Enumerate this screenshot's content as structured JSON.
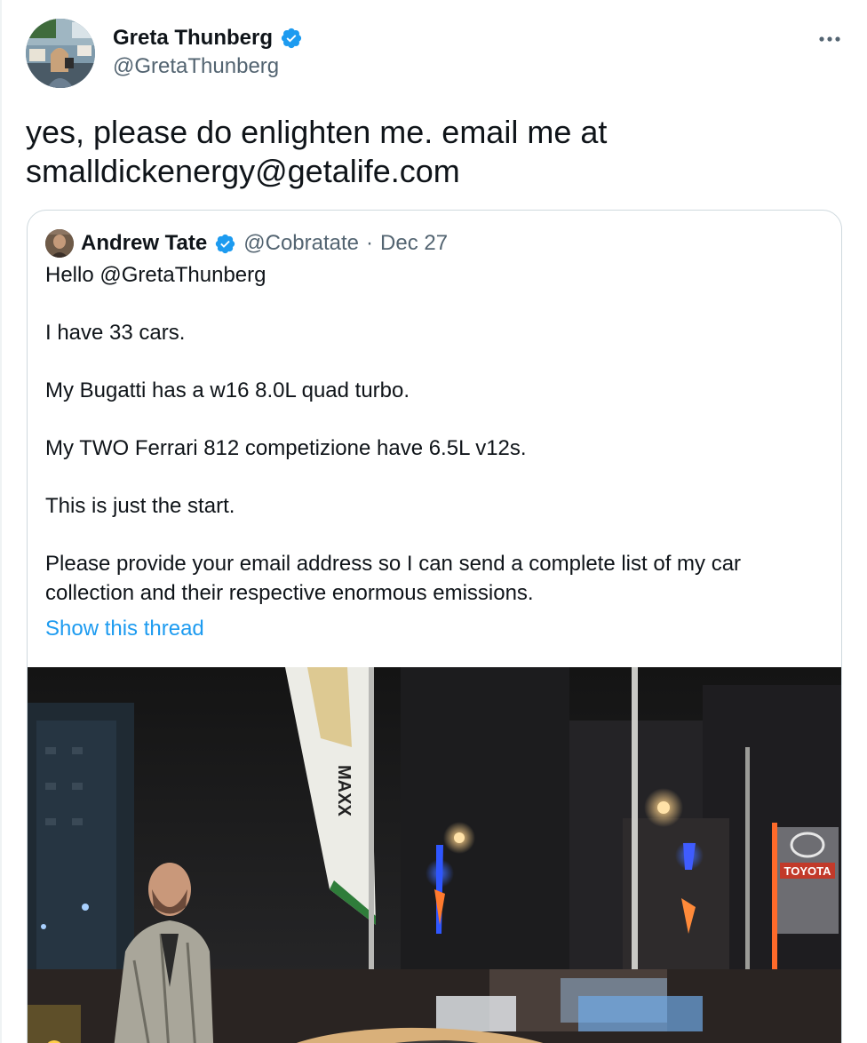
{
  "tweet": {
    "author": {
      "name": "Greta Thunberg",
      "handle": "@GretaThunberg",
      "verified": true
    },
    "text_lines": [
      "yes, please do enlighten me. email me at",
      "smalldickenergy@getalife.com"
    ],
    "more_icon": "more-horizontal-icon"
  },
  "quoted_tweet": {
    "author": {
      "name": "Andrew Tate",
      "handle": "@Cobratate",
      "verified": true
    },
    "separator": "·",
    "date": "Dec 27",
    "paragraphs": [
      "Hello @GretaThunberg",
      "I have 33 cars.",
      "My Bugatti has a w16 8.0L quad turbo.",
      "My TWO Ferrari 812 competizione have 6.5L v12s.",
      "This is just the start.",
      "Please provide your email address so I can send a complete list of my car collection and their respective enormous emissions."
    ],
    "show_thread": "Show this thread",
    "image": {
      "banner_text": "MAXX",
      "sign_text": "TOYOTA"
    }
  },
  "colors": {
    "link": "#1d9bf0",
    "verified": "#1d9bf0",
    "secondary_text": "#536471",
    "border": "#cfd9de"
  }
}
